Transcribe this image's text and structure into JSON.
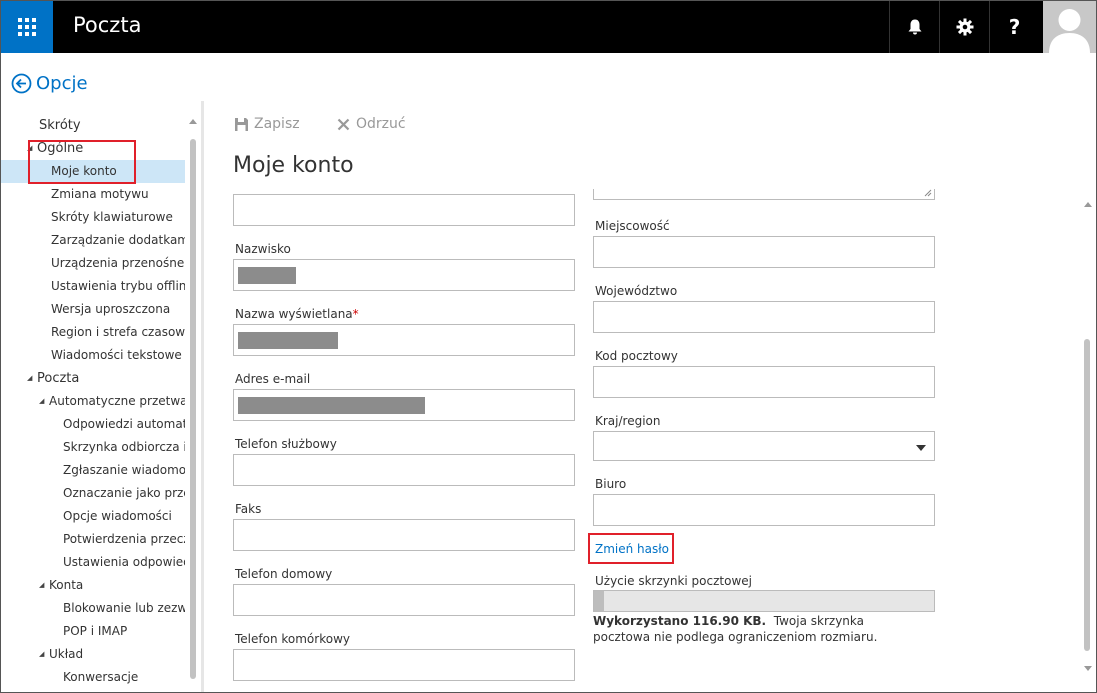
{
  "app": {
    "title": "Poczta"
  },
  "header": {
    "back_label": "Opcje"
  },
  "sidebar": {
    "items": [
      {
        "label": "Skróty",
        "level": 0,
        "expanded": null
      },
      {
        "label": "Ogólne",
        "level": 0,
        "expanded": true
      },
      {
        "label": "Moje konto",
        "level": 1,
        "selected": true
      },
      {
        "label": "Zmiana motywu",
        "level": 1
      },
      {
        "label": "Skróty klawiaturowe",
        "level": 1
      },
      {
        "label": "Zarządzanie dodatkami",
        "level": 1
      },
      {
        "label": "Urządzenia przenośne",
        "level": 1
      },
      {
        "label": "Ustawienia trybu offline",
        "level": 1
      },
      {
        "label": "Wersja uproszczona",
        "level": 1
      },
      {
        "label": "Region i strefa czasowa",
        "level": 1
      },
      {
        "label": "Wiadomości tekstowe",
        "level": 1
      },
      {
        "label": "Poczta",
        "level": 0,
        "expanded": true
      },
      {
        "label": "Automatyczne przetwarza",
        "level": 1,
        "expanded": true
      },
      {
        "label": "Odpowiedzi automatyc",
        "level": 2
      },
      {
        "label": "Skrzynka odbiorcza i re",
        "level": 2
      },
      {
        "label": "Zgłaszanie wiadomośc",
        "level": 2
      },
      {
        "label": "Oznaczanie jako przecz",
        "level": 2
      },
      {
        "label": "Opcje wiadomości",
        "level": 2
      },
      {
        "label": "Potwierdzenia przeczyt",
        "level": 2
      },
      {
        "label": "Ustawienia odpowiedzi",
        "level": 2
      },
      {
        "label": "Konta",
        "level": 1,
        "expanded": true
      },
      {
        "label": "Blokowanie lub zezwala",
        "level": 2
      },
      {
        "label": "POP i IMAP",
        "level": 2
      },
      {
        "label": "Układ",
        "level": 1,
        "expanded": true
      },
      {
        "label": "Konwersacje",
        "level": 2
      }
    ]
  },
  "commands": {
    "save": "Zapisz",
    "discard": "Odrzuć"
  },
  "main": {
    "title": "Moje konto",
    "left_fields": [
      {
        "label": "Nazwisko",
        "required": false
      },
      {
        "label": "Nazwa wyświetlana",
        "required": true
      },
      {
        "label": "Adres e-mail",
        "required": false
      },
      {
        "label": "Telefon służbowy",
        "required": false
      },
      {
        "label": "Faks",
        "required": false
      },
      {
        "label": "Telefon domowy",
        "required": false
      },
      {
        "label": "Telefon komórkowy",
        "required": false
      }
    ],
    "right_fields": [
      {
        "label": "Miejscowość"
      },
      {
        "label": "Województwo"
      },
      {
        "label": "Kod pocztowy"
      },
      {
        "label": "Kraj/region"
      },
      {
        "label": "Biuro"
      }
    ],
    "required_mark": "*",
    "change_password": "Zmień hasło",
    "usage": {
      "label": "Użycie skrzynki pocztowej",
      "used_bold": "Wykorzystano 116.90 KB.",
      "note": "Twoja skrzynka pocztowa nie podlega ograniczeniom rozmiaru.",
      "fill_fraction": 0.03
    }
  },
  "colors": {
    "accent": "#0072c6",
    "selection": "#cde6f7",
    "highlight_box": "#e0202a"
  }
}
